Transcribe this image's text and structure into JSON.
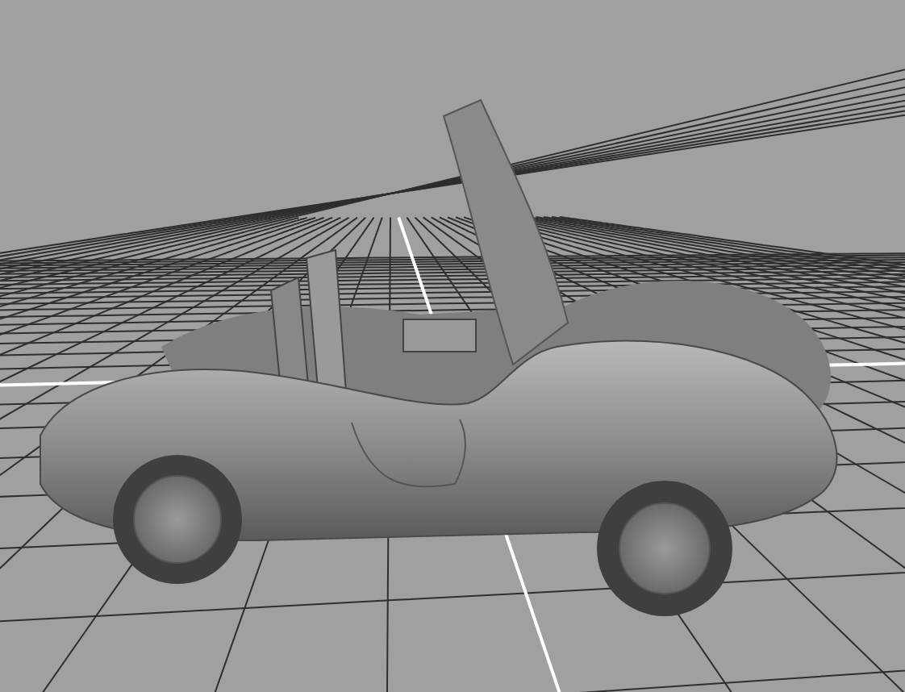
{
  "viewport": {
    "kind": "perspective",
    "grid": true
  }
}
